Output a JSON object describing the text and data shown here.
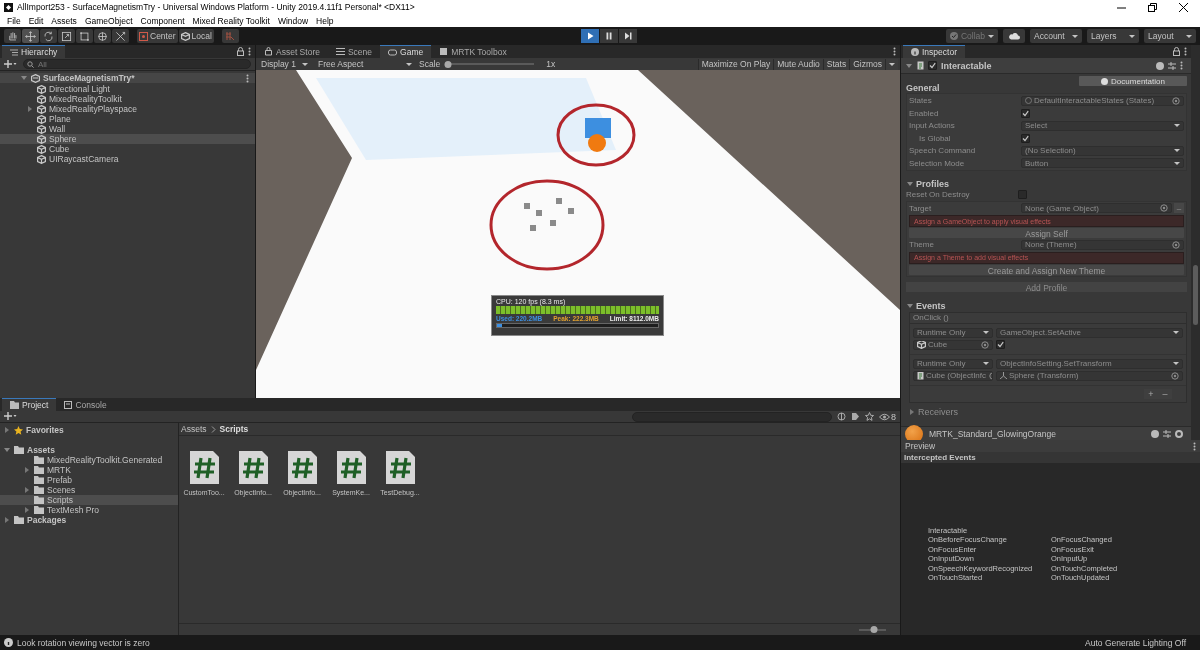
{
  "window": {
    "title": "AllImport253 - SurfaceMagnetismTry - Universal Windows Platform - Unity 2019.4.11f1 Personal* <DX11>"
  },
  "menu": [
    "File",
    "Edit",
    "Assets",
    "GameObject",
    "Component",
    "Mixed Reality Toolkit",
    "Window",
    "Help"
  ],
  "toolbar": {
    "tools": [
      {
        "kind": "hand",
        "selected": false
      },
      {
        "kind": "move",
        "selected": true
      },
      {
        "kind": "rotate",
        "selected": false
      },
      {
        "kind": "scale",
        "selected": false
      },
      {
        "kind": "rect",
        "selected": false
      },
      {
        "kind": "transform",
        "selected": false
      },
      {
        "kind": "custom",
        "selected": false
      }
    ],
    "pivot": [
      {
        "kind": "pivot",
        "label": "Center"
      },
      {
        "kind": "space",
        "label": "Local"
      }
    ],
    "play_controls": [
      {
        "kind": "play",
        "on": true
      },
      {
        "kind": "pause",
        "on": false
      },
      {
        "kind": "step",
        "on": false
      }
    ],
    "dropdowns": [
      {
        "kind": "collab",
        "label": "Collab",
        "disabled": true
      },
      {
        "kind": "cloud"
      },
      {
        "kind": "plain",
        "label": "Account",
        "disabled": false
      },
      {
        "kind": "plain",
        "label": "Layers",
        "disabled": false
      },
      {
        "kind": "plain",
        "label": "Layout",
        "disabled": false
      }
    ]
  },
  "hierarchy": {
    "title": "Hierarchy",
    "search": {
      "placeholder": "All"
    },
    "scene": {
      "name": "SurfaceMagnetismTry*",
      "expanded": true,
      "children": [
        {
          "name": "Directional Light",
          "selected": false
        },
        {
          "name": "MixedRealityToolkit",
          "selected": false
        },
        {
          "name": "MixedRealityPlayspace",
          "selected": false,
          "expanded": false
        },
        {
          "name": "Plane",
          "selected": false
        },
        {
          "name": "Wall",
          "selected": false
        },
        {
          "name": "Sphere",
          "selected": true
        },
        {
          "name": "Cube",
          "selected": false
        },
        {
          "name": "UIRaycastCamera",
          "selected": false
        }
      ]
    }
  },
  "center_tabs": [
    {
      "kind": "asset_store",
      "label": "Asset Store",
      "selected": false
    },
    {
      "kind": "scene",
      "label": "Scene",
      "selected": false
    },
    {
      "kind": "game",
      "label": "Game",
      "selected": true
    },
    {
      "kind": "mrtk",
      "label": "MRTK Toolbox",
      "selected": false
    }
  ],
  "game_view": {
    "display": "Display 1",
    "aspect": "Free Aspect",
    "scale_label": "Scale",
    "scale": {
      "level": 0
    },
    "scale_reading": "1x",
    "toggles": [
      {
        "label": "Maximize On Play",
        "on": false
      },
      {
        "label": "Mute Audio",
        "on": false
      },
      {
        "label": "Stats",
        "on": false
      },
      {
        "label": "Gizmos",
        "on": false
      }
    ],
    "stats": {
      "cpu": "CPU: 120 fps (8.3 ms)",
      "memory": [
        {
          "kind": "used",
          "label": "Used: 220.2MB"
        },
        {
          "kind": "peak",
          "label": "Peak: 222.3MB"
        },
        {
          "kind": "limit",
          "label": "Limit: 8112.0MB"
        }
      ],
      "memory_use": {
        "level": 0.03
      }
    }
  },
  "inspector": {
    "title": "Inspector",
    "component": {
      "name": "Interactable",
      "enabled": true,
      "documentation": "Documentation",
      "general": {
        "title": "General",
        "fields": [
          {
            "kind": "object",
            "label": "States",
            "value": "DefaultInteractableStates (States)"
          },
          {
            "kind": "toggle",
            "label": "Enabled",
            "checked": true
          },
          {
            "kind": "dropdown",
            "label": "Input Actions",
            "value": "Select",
            "children": [
              {
                "kind": "toggle",
                "label": "Is Global",
                "checked": true
              }
            ]
          },
          {
            "kind": "dropdown",
            "label": "Speech Command",
            "value": "(No Selection)"
          },
          {
            "kind": "dropdown",
            "label": "Selection Mode",
            "value": "Button"
          }
        ]
      },
      "profiles": {
        "title": "Profiles",
        "expanded": true,
        "reset_on_destroy": {
          "label": "Reset On Destroy",
          "checked": false
        },
        "profile": [
          {
            "kind": "object",
            "label": "Target",
            "value": "None (Game Object)",
            "remove_button": "–"
          },
          {
            "kind": "error",
            "text": "Assign a GameObject to apply visual effects"
          },
          {
            "kind": "button",
            "label": "Assign Self"
          },
          {
            "kind": "object",
            "label": "Theme",
            "value": "None (Theme)"
          },
          {
            "kind": "error",
            "text": "Assign a Theme to add visual effects"
          },
          {
            "kind": "button",
            "label": "Create and Assign New Theme"
          }
        ],
        "add": "Add Profile"
      },
      "events": {
        "title": "Events",
        "expanded": true,
        "onclick": {
          "title": "OnClick ()",
          "entries": [
            {
              "mode": "Runtime Only",
              "function": "GameObject.SetActive",
              "target": {
                "kind": "gameobject",
                "label": "Cube"
              },
              "argument": {
                "kind": "toggle",
                "checked": true
              }
            },
            {
              "mode": "Runtime Only",
              "function": "ObjectInfoSetting.SetTransform",
              "target": {
                "kind": "script",
                "label": "Cube (ObjectInfc"
              },
              "argument": {
                "kind": "object",
                "value": "Sphere (Transform)"
              }
            }
          ],
          "buttons": [
            "+",
            "–"
          ]
        },
        "receivers": {
          "title": "Receivers",
          "expanded": false
        }
      }
    },
    "material": {
      "name": "MRTK_Standard_GlowingOrange"
    }
  },
  "preview": {
    "title": "Preview",
    "heading": "Intercepted Events",
    "component": "Interactable",
    "events": [
      "OnBeforeFocusChange",
      "OnFocusChanged",
      "OnFocusEnter",
      "OnFocusExit",
      "OnInputDown",
      "OnInputUp",
      "OnSpeechKeywordRecognized",
      "OnTouchCompleted",
      "OnTouchStarted",
      "OnTouchUpdated"
    ]
  },
  "project": {
    "tabs": [
      {
        "kind": "project",
        "label": "Project",
        "selected": true
      },
      {
        "kind": "console",
        "label": "Console",
        "selected": false
      }
    ],
    "hidden_count": "8",
    "tree": [
      {
        "kind": "favorites",
        "name": "Favorites",
        "expanded": false,
        "selected": false
      },
      {
        "kind": "folder",
        "name": "Assets",
        "expanded": true,
        "selected": false,
        "children": [
          {
            "kind": "folder",
            "name": "MixedRealityToolkit.Generated",
            "selected": false
          },
          {
            "kind": "folder",
            "name": "MRTK",
            "selected": false,
            "expanded": false
          },
          {
            "kind": "folder",
            "name": "Prefab",
            "selected": false
          },
          {
            "kind": "folder",
            "name": "Scenes",
            "selected": false,
            "expanded": false
          },
          {
            "kind": "folder",
            "name": "Scripts",
            "selected": true
          },
          {
            "kind": "folder",
            "name": "TextMesh Pro",
            "selected": false,
            "expanded": false
          }
        ]
      },
      {
        "kind": "folder",
        "name": "Packages",
        "expanded": false,
        "selected": false
      }
    ],
    "breadcrumb": [
      "Assets",
      "Scripts"
    ],
    "files": [
      "CustomToo...",
      "ObjectInfo...",
      "ObjectInfo...",
      "SystemKe...",
      "TestDebug..."
    ],
    "icon_size": {
      "level": 0.55
    }
  },
  "status_bar": {
    "message": "Look rotation viewing vector is zero",
    "lighting": "Auto Generate Lighting Off"
  }
}
